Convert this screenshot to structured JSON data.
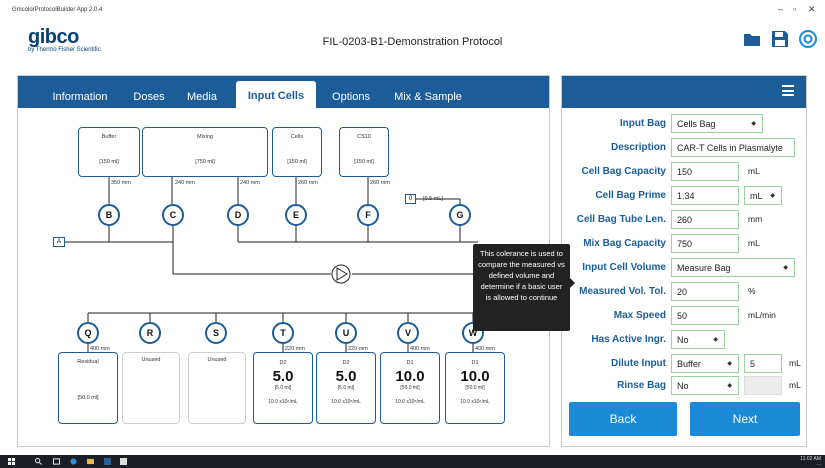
{
  "window": {
    "title": "GmcolorProtocolBuilder App 2.0.4"
  },
  "header": {
    "logo_word": "gibco",
    "logo_by": "by Thermo Fisher Scientific",
    "document_title": "FIL-0203-B1-Demonstration Protocol"
  },
  "tabs": [
    {
      "label": "Information"
    },
    {
      "label": "Doses"
    },
    {
      "label": "Media"
    },
    {
      "label": "Input Cells",
      "active": true
    },
    {
      "label": "Options"
    },
    {
      "label": "Mix & Sample"
    }
  ],
  "diagram": {
    "top_bags": [
      {
        "name": "Buffer",
        "volume": "[150 ml]"
      },
      {
        "name": "Mixing",
        "volume": "[750 ml]"
      },
      {
        "name": "Cells",
        "volume": "[150 ml]"
      },
      {
        "name": "CS10",
        "volume": "[150 ml]"
      }
    ],
    "top_tubes": [
      "350 mm",
      "240 mm",
      "240 mm",
      "260 mm",
      "260 mm"
    ],
    "waste_label": "0",
    "waste_volume": "[0.5 mL]",
    "upper_nodes": [
      "B",
      "C",
      "D",
      "E",
      "F",
      "G"
    ],
    "inlet_label": "A",
    "lower_nodes": [
      "Q",
      "R",
      "S",
      "T",
      "U",
      "V",
      "W"
    ],
    "lower_tubes": [
      "400 mm",
      "220 mm",
      "220 mm",
      "400 mm",
      "400 mm"
    ],
    "bottom_bags": [
      {
        "name": "Residual",
        "big": "",
        "vol": "",
        "note": "[50.0 ml]",
        "conc": ""
      },
      {
        "name": "Unused",
        "big": "",
        "vol": "",
        "note": "",
        "conc": ""
      },
      {
        "name": "Unused",
        "big": "",
        "vol": "",
        "note": "",
        "conc": ""
      },
      {
        "name": "D2",
        "big": "5.0",
        "vol": "[5.0 ml]",
        "note": "",
        "conc": "10.0 x10⁶/mL"
      },
      {
        "name": "D2",
        "big": "5.0",
        "vol": "[5.0 ml]",
        "note": "",
        "conc": "10.0 x10⁶/mL"
      },
      {
        "name": "D1",
        "big": "10.0",
        "vol": "[50.0 ml]",
        "note": "",
        "conc": "10.0 x10⁶/mL"
      },
      {
        "name": "D1",
        "big": "10.0",
        "vol": "[50.0 ml]",
        "note": "",
        "conc": "10.0 x10⁶/mL"
      }
    ]
  },
  "tooltip": {
    "text": "This colerance is used to compare the measured vs defined volume and determine if a basic user is allowed to continue"
  },
  "form": {
    "input_bag": {
      "label": "Input Bag",
      "value": "Cells Bag"
    },
    "description": {
      "label": "Description",
      "value": "CAR-T Cells in Plasmalyte"
    },
    "cell_bag_capacity": {
      "label": "Cell Bag Capacity",
      "value": "150",
      "unit": "mL"
    },
    "cell_bag_prime": {
      "label": "Cell Bag Prime",
      "value": "1.34",
      "unit": "mL"
    },
    "cell_bag_tube_len": {
      "label": "Cell Bag Tube Len.",
      "value": "260",
      "unit": "mm"
    },
    "mix_bag_capacity": {
      "label": "Mix Bag Capacity",
      "value": "750",
      "unit": "mL"
    },
    "input_cell_volume": {
      "label": "Input Cell Volume",
      "value": "Measure Bag"
    },
    "measured_vol_tol": {
      "label": "Measured Vol. Tol.",
      "value": "20",
      "unit": "%"
    },
    "max_speed": {
      "label": "Max Speed",
      "value": "50",
      "unit": "mL/min"
    },
    "has_active_ingr": {
      "label": "Has Active Ingr.",
      "value": "No"
    },
    "dilute_input": {
      "label": "Dilute Input",
      "value": "Buffer",
      "amount": "5",
      "unit": "mL"
    },
    "rinse_bag": {
      "label": "Rinse Bag",
      "value": "No",
      "amount": "",
      "unit": "mL"
    }
  },
  "buttons": {
    "back": "Back",
    "next": "Next"
  },
  "taskbar": {
    "time": "11:02 AM",
    "date": "..."
  },
  "colors": {
    "primary": "#1c5d99",
    "button": "#1c8ad6",
    "input_border": "#9bd29f"
  }
}
